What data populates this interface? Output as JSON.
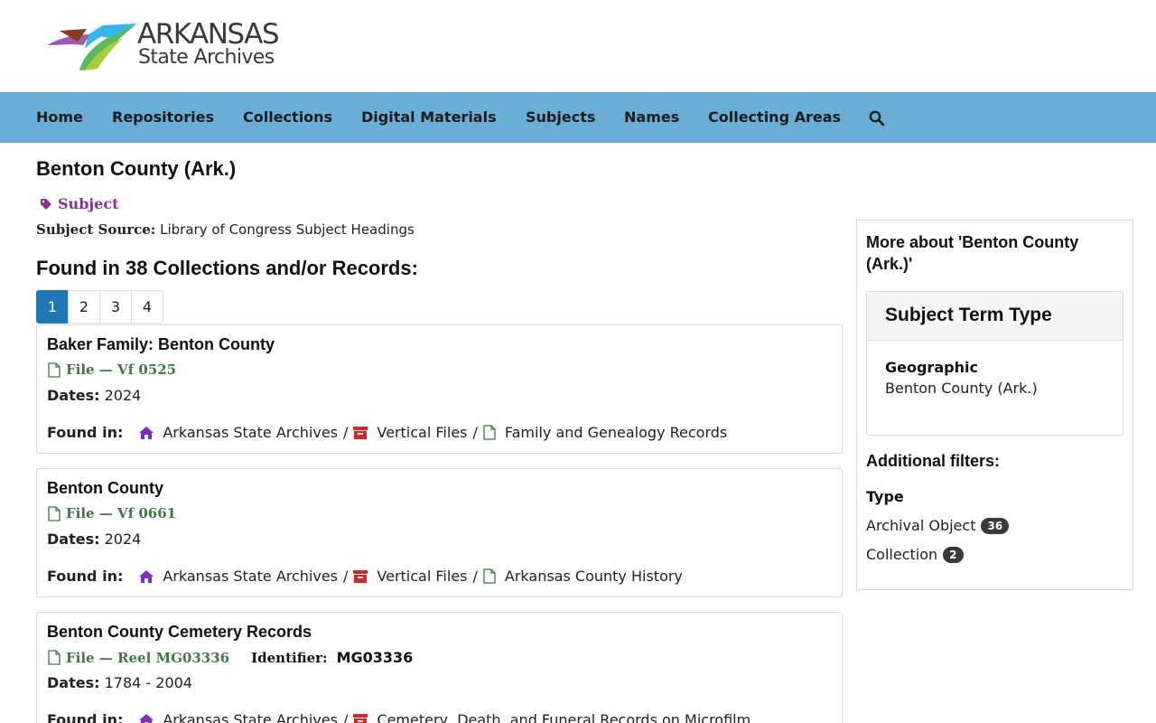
{
  "logo": {
    "line1": "ARKANSAS",
    "line2": "State Archives"
  },
  "nav": {
    "items": [
      "Home",
      "Repositories",
      "Collections",
      "Digital Materials",
      "Subjects",
      "Names",
      "Collecting Areas"
    ],
    "search_icon": "search-icon"
  },
  "page": {
    "title": "Benton County (Ark.)",
    "type_badge": "Subject",
    "subject_source_label": "Subject Source:",
    "subject_source_value": "Library of Congress Subject Headings",
    "found_heading": "Found in 38 Collections and/or Records:"
  },
  "pagination": {
    "pages": [
      "1",
      "2",
      "3",
      "4"
    ],
    "active": "1"
  },
  "records": [
    {
      "title": "Baker Family: Benton County",
      "type": "File — Vf 0525",
      "dates_label": "Dates:",
      "dates": "2024",
      "found_label": "Found in:",
      "repo": "Arkansas State Archives",
      "collection": "Vertical Files",
      "series": "Family and Genealogy Records"
    },
    {
      "title": "Benton County",
      "type": "File — Vf 0661",
      "dates_label": "Dates:",
      "dates": "2024",
      "found_label": "Found in:",
      "repo": "Arkansas State Archives",
      "collection": "Vertical Files",
      "series": "Arkansas County History"
    },
    {
      "title": "Benton County Cemetery Records",
      "type": "File — Reel MG03336",
      "identifier_label": "Identifier:",
      "identifier": "MG03336",
      "dates_label": "Dates:",
      "dates": "1784 - 2004",
      "found_label": "Found in:",
      "repo": "Arkansas State Archives",
      "collection": "Cemetery, Death, and Funeral Records on Microfilm"
    }
  ],
  "sidebar": {
    "heading": "More about 'Benton County (Ark.)'",
    "panel_title": "Subject Term Type",
    "term_label": "Geographic",
    "term_value": "Benton County (Ark.)",
    "additional_filters": "Additional filters:",
    "type_label": "Type",
    "filters": [
      {
        "label": "Archival Object",
        "count": "36"
      },
      {
        "label": "Collection",
        "count": "2"
      }
    ]
  },
  "colors": {
    "navbar": "#68aed6",
    "subject_badge": "#8b2f9b",
    "record_type": "#3f7a3f",
    "active_page": "#1f77b4",
    "repo_icon": "#7b2fbf",
    "collection_icon": "#d62728"
  }
}
